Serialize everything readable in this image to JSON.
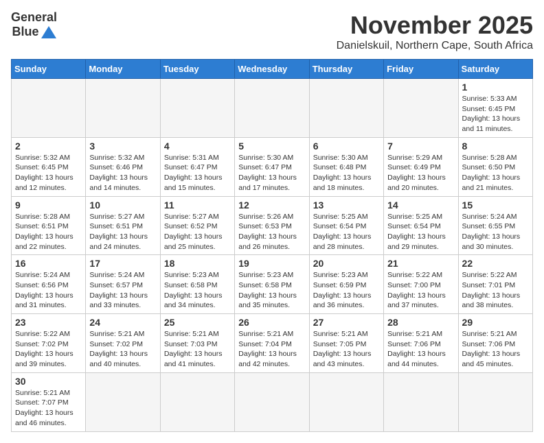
{
  "logo": {
    "line1": "General",
    "line2": "Blue"
  },
  "title": "November 2025",
  "subtitle": "Danielskuil, Northern Cape, South Africa",
  "days_of_week": [
    "Sunday",
    "Monday",
    "Tuesday",
    "Wednesday",
    "Thursday",
    "Friday",
    "Saturday"
  ],
  "weeks": [
    [
      {
        "day": "",
        "info": ""
      },
      {
        "day": "",
        "info": ""
      },
      {
        "day": "",
        "info": ""
      },
      {
        "day": "",
        "info": ""
      },
      {
        "day": "",
        "info": ""
      },
      {
        "day": "",
        "info": ""
      },
      {
        "day": "1",
        "info": "Sunrise: 5:33 AM\nSunset: 6:45 PM\nDaylight: 13 hours and 11 minutes."
      }
    ],
    [
      {
        "day": "2",
        "info": "Sunrise: 5:32 AM\nSunset: 6:45 PM\nDaylight: 13 hours and 12 minutes."
      },
      {
        "day": "3",
        "info": "Sunrise: 5:32 AM\nSunset: 6:46 PM\nDaylight: 13 hours and 14 minutes."
      },
      {
        "day": "4",
        "info": "Sunrise: 5:31 AM\nSunset: 6:47 PM\nDaylight: 13 hours and 15 minutes."
      },
      {
        "day": "5",
        "info": "Sunrise: 5:30 AM\nSunset: 6:47 PM\nDaylight: 13 hours and 17 minutes."
      },
      {
        "day": "6",
        "info": "Sunrise: 5:30 AM\nSunset: 6:48 PM\nDaylight: 13 hours and 18 minutes."
      },
      {
        "day": "7",
        "info": "Sunrise: 5:29 AM\nSunset: 6:49 PM\nDaylight: 13 hours and 20 minutes."
      },
      {
        "day": "8",
        "info": "Sunrise: 5:28 AM\nSunset: 6:50 PM\nDaylight: 13 hours and 21 minutes."
      }
    ],
    [
      {
        "day": "9",
        "info": "Sunrise: 5:28 AM\nSunset: 6:51 PM\nDaylight: 13 hours and 22 minutes."
      },
      {
        "day": "10",
        "info": "Sunrise: 5:27 AM\nSunset: 6:51 PM\nDaylight: 13 hours and 24 minutes."
      },
      {
        "day": "11",
        "info": "Sunrise: 5:27 AM\nSunset: 6:52 PM\nDaylight: 13 hours and 25 minutes."
      },
      {
        "day": "12",
        "info": "Sunrise: 5:26 AM\nSunset: 6:53 PM\nDaylight: 13 hours and 26 minutes."
      },
      {
        "day": "13",
        "info": "Sunrise: 5:25 AM\nSunset: 6:54 PM\nDaylight: 13 hours and 28 minutes."
      },
      {
        "day": "14",
        "info": "Sunrise: 5:25 AM\nSunset: 6:54 PM\nDaylight: 13 hours and 29 minutes."
      },
      {
        "day": "15",
        "info": "Sunrise: 5:24 AM\nSunset: 6:55 PM\nDaylight: 13 hours and 30 minutes."
      }
    ],
    [
      {
        "day": "16",
        "info": "Sunrise: 5:24 AM\nSunset: 6:56 PM\nDaylight: 13 hours and 31 minutes."
      },
      {
        "day": "17",
        "info": "Sunrise: 5:24 AM\nSunset: 6:57 PM\nDaylight: 13 hours and 33 minutes."
      },
      {
        "day": "18",
        "info": "Sunrise: 5:23 AM\nSunset: 6:58 PM\nDaylight: 13 hours and 34 minutes."
      },
      {
        "day": "19",
        "info": "Sunrise: 5:23 AM\nSunset: 6:58 PM\nDaylight: 13 hours and 35 minutes."
      },
      {
        "day": "20",
        "info": "Sunrise: 5:23 AM\nSunset: 6:59 PM\nDaylight: 13 hours and 36 minutes."
      },
      {
        "day": "21",
        "info": "Sunrise: 5:22 AM\nSunset: 7:00 PM\nDaylight: 13 hours and 37 minutes."
      },
      {
        "day": "22",
        "info": "Sunrise: 5:22 AM\nSunset: 7:01 PM\nDaylight: 13 hours and 38 minutes."
      }
    ],
    [
      {
        "day": "23",
        "info": "Sunrise: 5:22 AM\nSunset: 7:02 PM\nDaylight: 13 hours and 39 minutes."
      },
      {
        "day": "24",
        "info": "Sunrise: 5:21 AM\nSunset: 7:02 PM\nDaylight: 13 hours and 40 minutes."
      },
      {
        "day": "25",
        "info": "Sunrise: 5:21 AM\nSunset: 7:03 PM\nDaylight: 13 hours and 41 minutes."
      },
      {
        "day": "26",
        "info": "Sunrise: 5:21 AM\nSunset: 7:04 PM\nDaylight: 13 hours and 42 minutes."
      },
      {
        "day": "27",
        "info": "Sunrise: 5:21 AM\nSunset: 7:05 PM\nDaylight: 13 hours and 43 minutes."
      },
      {
        "day": "28",
        "info": "Sunrise: 5:21 AM\nSunset: 7:06 PM\nDaylight: 13 hours and 44 minutes."
      },
      {
        "day": "29",
        "info": "Sunrise: 5:21 AM\nSunset: 7:06 PM\nDaylight: 13 hours and 45 minutes."
      }
    ],
    [
      {
        "day": "30",
        "info": "Sunrise: 5:21 AM\nSunset: 7:07 PM\nDaylight: 13 hours and 46 minutes."
      },
      {
        "day": "",
        "info": ""
      },
      {
        "day": "",
        "info": ""
      },
      {
        "day": "",
        "info": ""
      },
      {
        "day": "",
        "info": ""
      },
      {
        "day": "",
        "info": ""
      },
      {
        "day": "",
        "info": ""
      }
    ]
  ]
}
